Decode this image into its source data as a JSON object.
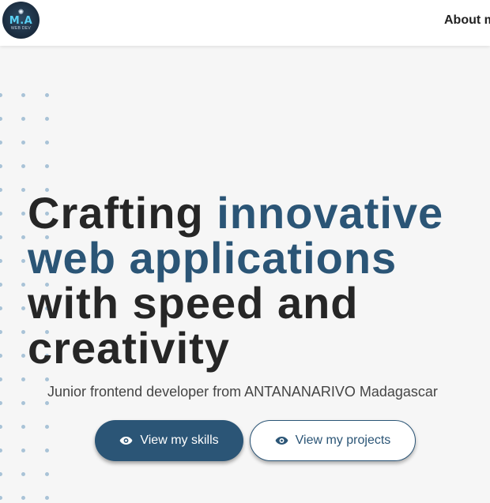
{
  "header": {
    "logo": {
      "mark": "M.A",
      "subtitle": "WEB DEV",
      "icon": "logo-icon"
    },
    "nav": {
      "about_label": "About m"
    }
  },
  "hero": {
    "headline": {
      "line1_plain": "Crafting ",
      "line1_accent": "innovative",
      "line2_accent": "web applications",
      "line3": "with speed and",
      "line4": "creativity"
    },
    "subtitle": "Junior frontend developer from ANTANANARIVO Madagascar",
    "buttons": {
      "skills_label": "View my skills",
      "projects_label": "View my projects",
      "icon": "eye-icon"
    }
  },
  "colors": {
    "accent": "#2b5576",
    "text_dark": "#262626",
    "background": "#f6f6f6",
    "dots": "#a9c3d7"
  }
}
